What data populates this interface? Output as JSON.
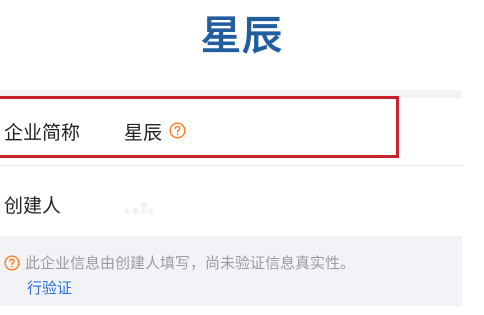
{
  "theme": {
    "title_color": "#225e9f",
    "accent_color": "#ff7a1c",
    "highlight_color": "#c8232c",
    "link_color": "#2b6fd7"
  },
  "header": {
    "title": "星辰"
  },
  "company_row": {
    "label": "企业简称",
    "value": "星辰",
    "icon": "question-circle-icon"
  },
  "creator_row": {
    "label": "创建人",
    "value": "ˎ¸ˏ̵ˏ",
    "redacted": true
  },
  "info_notice": {
    "icon": "question-circle-icon",
    "text": "此企业信息由创建人填写，尚未验证信息真实性。",
    "link_label": "行验证"
  }
}
